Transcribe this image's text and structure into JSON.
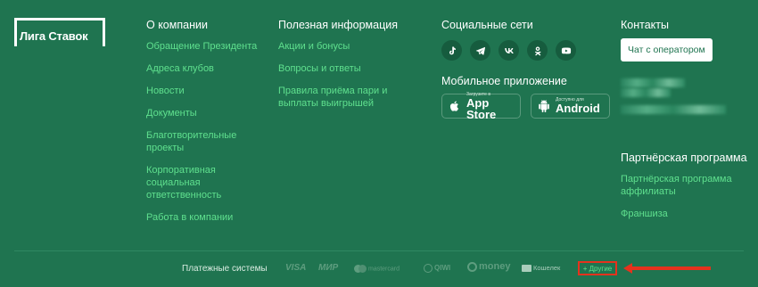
{
  "logo": {
    "text": "Лига Ставок"
  },
  "about": {
    "title": "О компании",
    "links": [
      "Обращение Президента",
      "Адреса клубов",
      "Новости",
      "Документы",
      "Благотворительные проекты",
      "Корпоративная социальная ответственность",
      "Работа в компании"
    ]
  },
  "useful": {
    "title": "Полезная информация",
    "links": [
      "Акции и бонусы",
      "Вопросы и ответы",
      "Правила приёма пари и выплаты выигрышей"
    ]
  },
  "social": {
    "title": "Социальные сети",
    "icons": [
      "tiktok-icon",
      "telegram-icon",
      "vk-icon",
      "odnoklassniki-icon",
      "youtube-icon"
    ]
  },
  "mobile": {
    "title": "Мобильное приложение",
    "appstore_small": "Загрузите в",
    "appstore_big": "App Store",
    "android_small": "Доступно для",
    "android_big": "Android"
  },
  "contacts": {
    "title": "Контакты",
    "chat_button": "Чат с оператором"
  },
  "partner": {
    "title": "Партнёрская программа",
    "links": [
      "Партнёрская программа аффилиаты",
      "Франшиза"
    ]
  },
  "payments": {
    "label": "Платежные системы",
    "items": [
      "VISA",
      "МИР",
      "mastercard",
      "QIWI",
      "money",
      "Кошелек",
      "+ Другие"
    ]
  },
  "colors": {
    "background": "#1f7450",
    "link": "#5fe08e",
    "highlight": "#e5321d"
  }
}
